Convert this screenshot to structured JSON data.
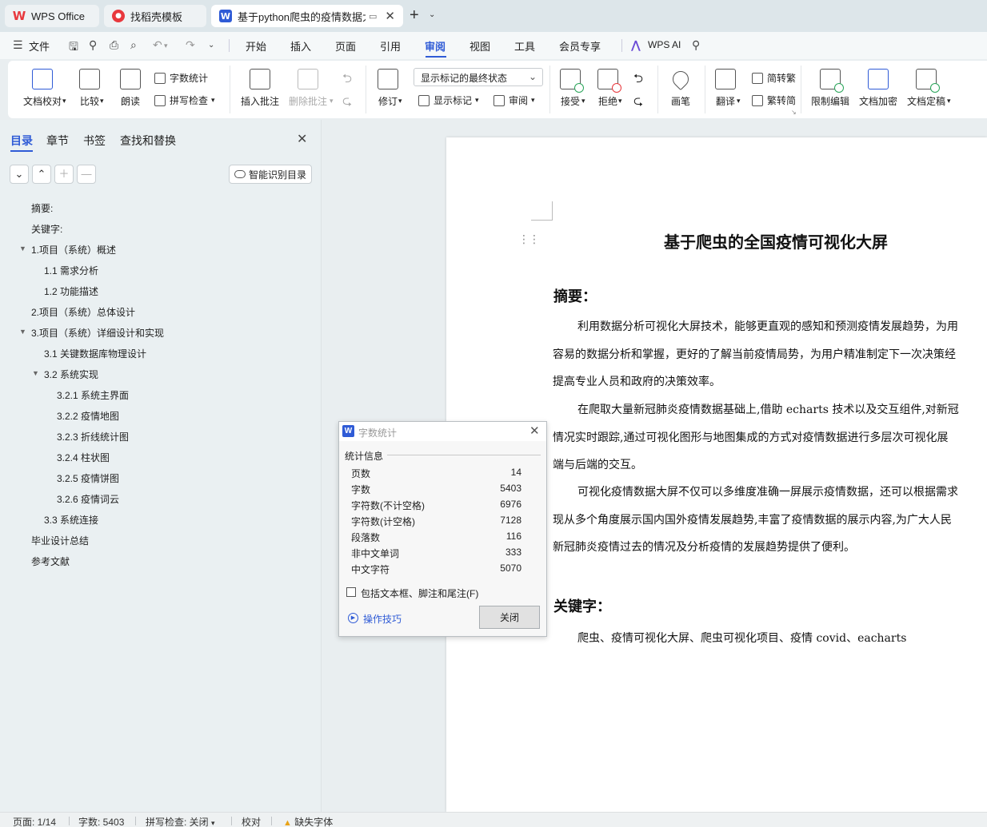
{
  "tabs": {
    "wps_office": "WPS Office",
    "templates": "找稻壳模板",
    "document": "基于python爬虫的疫情数据大",
    "add": "+",
    "more": "⌄"
  },
  "menu": {
    "file": "文件",
    "items": [
      "开始",
      "插入",
      "页面",
      "引用",
      "审阅",
      "视图",
      "工具",
      "会员专享"
    ],
    "wps_ai": "WPS AI"
  },
  "ribbon": {
    "proofread": "文档校对",
    "compare": "比较",
    "read_aloud": "朗读",
    "word_count": "字数统计",
    "spell_check": "拼写检查",
    "insert_comment": "插入批注",
    "delete_comment": "删除批注",
    "track_changes": "修订",
    "markup_state": "显示标记的最终状态",
    "show_markup": "显示标记",
    "review_pane": "审阅",
    "accept": "接受",
    "reject": "拒绝",
    "pen": "画笔",
    "translate": "翻译",
    "to_traditional": "简转繁",
    "to_simplified": "繁转简",
    "restrict_edit": "限制编辑",
    "encrypt": "文档加密",
    "finalize": "文档定稿"
  },
  "nav": {
    "tabs": [
      "目录",
      "章节",
      "书签",
      "查找和替换"
    ],
    "smart_toc": "智能识别目录",
    "toc": [
      {
        "label": "摘要:",
        "level": 1,
        "collapsible": false
      },
      {
        "label": "关键字:",
        "level": 1,
        "collapsible": false
      },
      {
        "label": "1.项目（系统）概述",
        "level": 1,
        "collapsible": true
      },
      {
        "label": "1.1 需求分析",
        "level": 2,
        "collapsible": false
      },
      {
        "label": "1.2 功能描述",
        "level": 2,
        "collapsible": false
      },
      {
        "label": "2.项目（系统）总体设计",
        "level": 1,
        "collapsible": false
      },
      {
        "label": "3.项目（系统）详细设计和实现",
        "level": 1,
        "collapsible": true
      },
      {
        "label": "3.1 关键数据库物理设计",
        "level": 2,
        "collapsible": false
      },
      {
        "label": "3.2 系统实现",
        "level": 2,
        "collapsible": true
      },
      {
        "label": "3.2.1 系统主界面",
        "level": 3,
        "collapsible": false
      },
      {
        "label": "3.2.2 疫情地图",
        "level": 3,
        "collapsible": false
      },
      {
        "label": "3.2.3 折线统计图",
        "level": 3,
        "collapsible": false
      },
      {
        "label": "3.2.4 柱状图",
        "level": 3,
        "collapsible": false
      },
      {
        "label": "3.2.5 疫情饼图",
        "level": 3,
        "collapsible": false
      },
      {
        "label": "3.2.6 疫情词云",
        "level": 3,
        "collapsible": false
      },
      {
        "label": "3.3 系统连接",
        "level": 2,
        "collapsible": false
      },
      {
        "label": "毕业设计总结",
        "level": 1,
        "collapsible": false
      },
      {
        "label": "参考文献",
        "level": 1,
        "collapsible": false
      }
    ]
  },
  "document": {
    "title": "基于爬虫的全国疫情可视化大屏",
    "abstract_heading": "摘要：",
    "abstract_lines": [
      "利用数据分析可视化大屏技术，能够更直观的感知和预测疫情发展趋势，为用",
      "容易的数据分析和掌握，更好的了解当前疫情局势，为用户精准制定下一次决策经",
      "提高专业人员和政府的决策效率。",
      "在爬取大量新冠肺炎疫情数据基础上,借助 echarts  技术以及交互组件,对新冠",
      "情况实时跟踪,通过可视化图形与地图集成的方式对疫情数据进行多层次可视化展",
      "端与后端的交互。",
      "可视化疫情数据大屏不仅可以多维度准确一屏展示疫情数据，还可以根据需求",
      "现从多个角度展示国内国外疫情发展趋势,丰富了疫情数据的展示内容,为广大人民",
      "新冠肺炎疫情过去的情况及分析疫情的发展趋势提供了便利。"
    ],
    "keywords_heading": "关键字：",
    "keywords": "爬虫、疫情可视化大屏、爬虫可视化项目、疫情  covid、eacharts"
  },
  "word_count_dialog": {
    "title": "字数统计",
    "section": "统计信息",
    "rows": [
      {
        "label": "页数",
        "value": "14"
      },
      {
        "label": "字数",
        "value": "5403"
      },
      {
        "label": "字符数(不计空格)",
        "value": "6976"
      },
      {
        "label": "字符数(计空格)",
        "value": "7128"
      },
      {
        "label": "段落数",
        "value": "116"
      },
      {
        "label": "非中文单词",
        "value": "333"
      },
      {
        "label": "中文字符",
        "value": "5070"
      }
    ],
    "include_label": "包括文本框、脚注和尾注(F)",
    "tips": "操作技巧",
    "close": "关闭"
  },
  "status": {
    "page": "页面: 1/14",
    "words": "字数: 5403",
    "spell": "拼写检查: 关闭",
    "proof": "校对",
    "missing_font": "缺失字体"
  },
  "colors": {
    "accent": "#2f5bd6",
    "brand_red": "#e8383d"
  }
}
